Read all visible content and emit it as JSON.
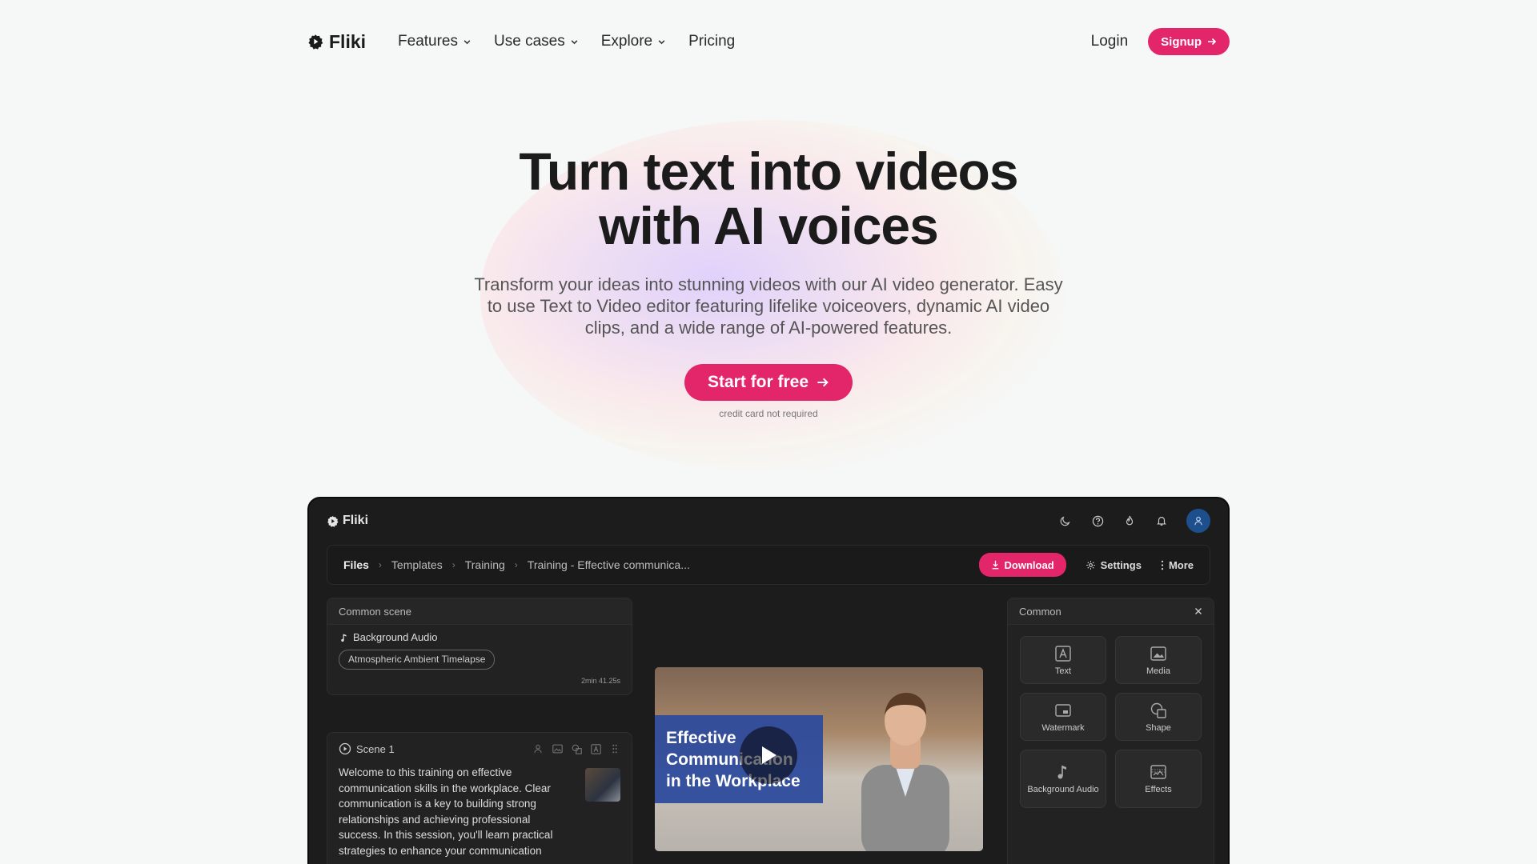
{
  "nav": {
    "logo": "Fliki",
    "links": [
      {
        "label": "Features",
        "dropdown": true
      },
      {
        "label": "Use cases",
        "dropdown": true
      },
      {
        "label": "Explore",
        "dropdown": true
      },
      {
        "label": "Pricing",
        "dropdown": false
      }
    ],
    "login": "Login",
    "signup": "Signup"
  },
  "hero": {
    "title_line1": "Turn text into videos",
    "title_line2": "with AI voices",
    "subtitle": "Transform your ideas into stunning videos with our AI video generator. Easy to use Text to Video editor featuring lifelike voiceovers, dynamic AI video clips, and a wide range of AI-powered features.",
    "cta": "Start for free",
    "note": "credit card not required"
  },
  "app": {
    "logo": "Fliki",
    "breadcrumb": [
      "Files",
      "Templates",
      "Training",
      "Training - Effective communica..."
    ],
    "actions": {
      "download": "Download",
      "settings": "Settings",
      "more": "More"
    },
    "common_scene": {
      "title": "Common scene",
      "bg_audio_label": "Background Audio",
      "track": "Atmospheric Ambient Timelapse",
      "duration": "2min 41.25s"
    },
    "scene1": {
      "label": "Scene 1",
      "text": "Welcome to this training on effective communication skills in the workplace. Clear communication is a key to building strong relationships and achieving professional success. In this session, you'll learn practical strategies to enhance your communication"
    },
    "video": {
      "title_lines": [
        "Effective",
        "Communication",
        "in the Workplace"
      ]
    },
    "common_panel": {
      "title": "Common",
      "tiles": [
        "Text",
        "Media",
        "Watermark",
        "Shape",
        "Background Audio",
        "Effects"
      ]
    }
  },
  "colors": {
    "accent": "#e3266a",
    "dark_bg": "#1c1c1c",
    "page_bg": "#f6f7f7"
  }
}
